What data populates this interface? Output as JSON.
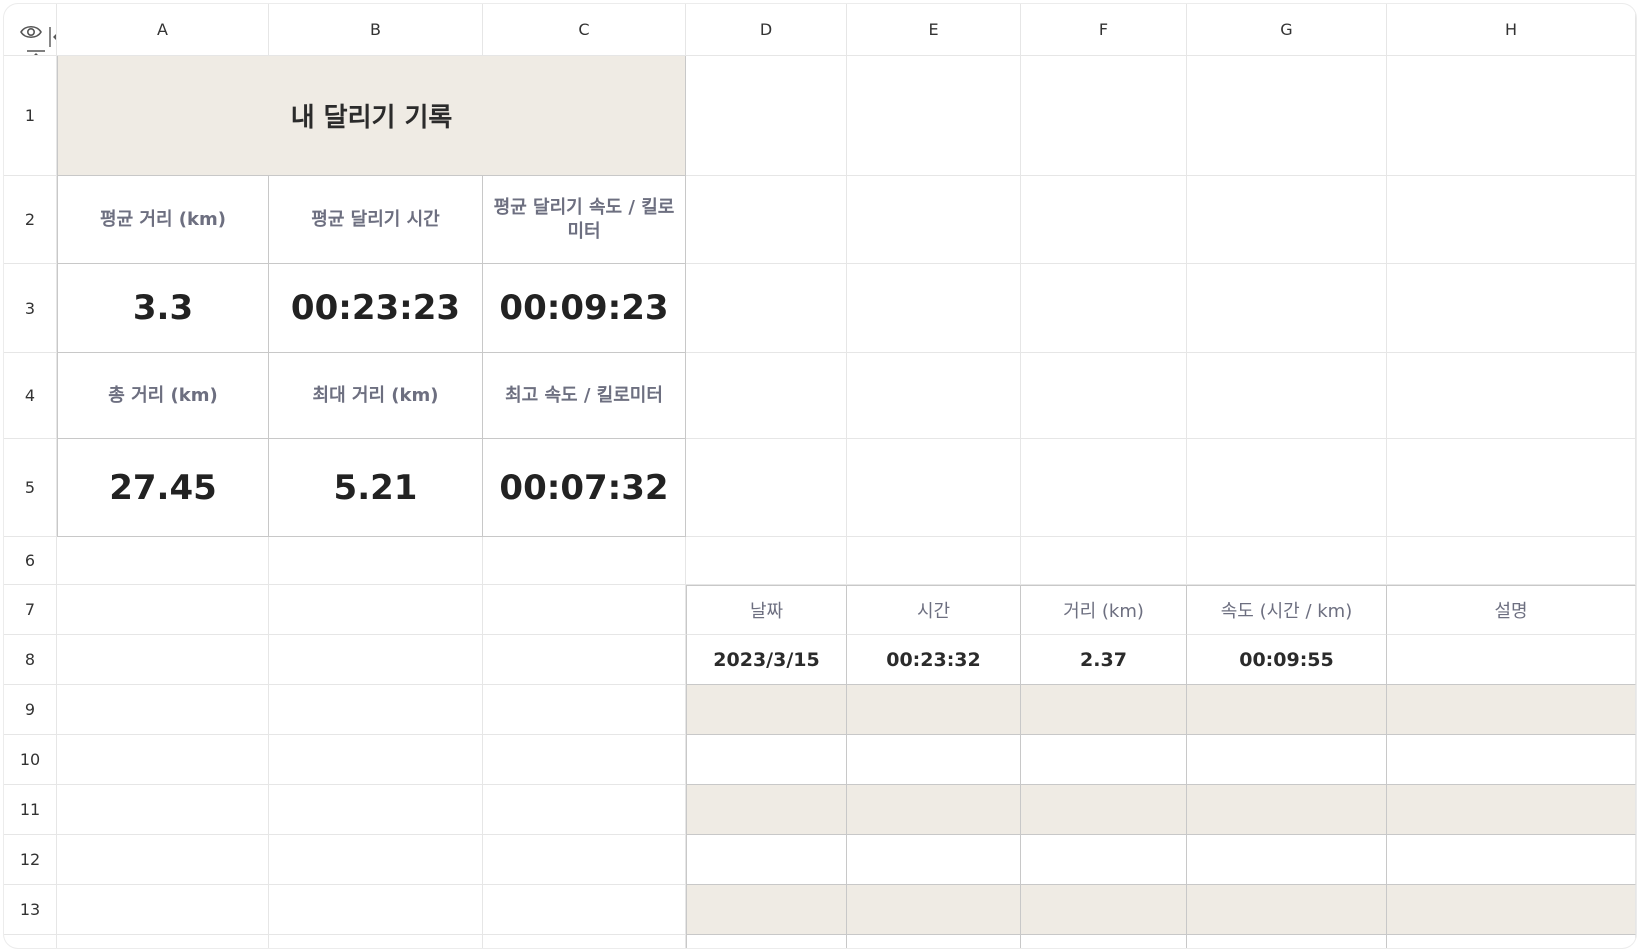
{
  "columns": [
    "A",
    "B",
    "C",
    "D",
    "E",
    "F",
    "G",
    "H"
  ],
  "rows": [
    "1",
    "2",
    "3",
    "4",
    "5",
    "6",
    "7",
    "8",
    "9",
    "10",
    "11",
    "12",
    "13"
  ],
  "title": "내 달리기 기록",
  "summary": {
    "avg_distance_label": "평균 거리 (km)",
    "avg_time_label": "평균 달리기 시간",
    "avg_pace_label": "평균 달리기 속도 / 킬로미터",
    "avg_distance_value": "3.3",
    "avg_time_value": "00:23:23",
    "avg_pace_value": "00:09:23",
    "total_distance_label": "총 거리 (km)",
    "max_distance_label": "최대 거리 (km)",
    "best_pace_label": "최고 속도 / 킬로미터",
    "total_distance_value": "27.45",
    "max_distance_value": "5.21",
    "best_pace_value": "00:07:32"
  },
  "log_table": {
    "headers": [
      "날짜",
      "시간",
      "거리 (km)",
      "속도 (시간 / km)",
      "설명"
    ],
    "rows": [
      [
        "2023/3/15",
        "00:23:32",
        "2.37",
        "00:09:55",
        ""
      ],
      [
        "",
        "",
        "",
        "",
        ""
      ],
      [
        "",
        "",
        "",
        "",
        ""
      ],
      [
        "",
        "",
        "",
        "",
        ""
      ],
      [
        "",
        "",
        "",
        "",
        ""
      ],
      [
        "",
        "",
        "",
        "",
        ""
      ]
    ]
  },
  "colors": {
    "header_fill": "#efebe4",
    "label_text": "#6d6f80",
    "border": "#c8c8c8",
    "gridline": "#e6e6e6"
  },
  "icons": {
    "corner_view": "eye-icon",
    "column_resize": "expand-columns-icon",
    "row_resize": "expand-rows-icon"
  }
}
